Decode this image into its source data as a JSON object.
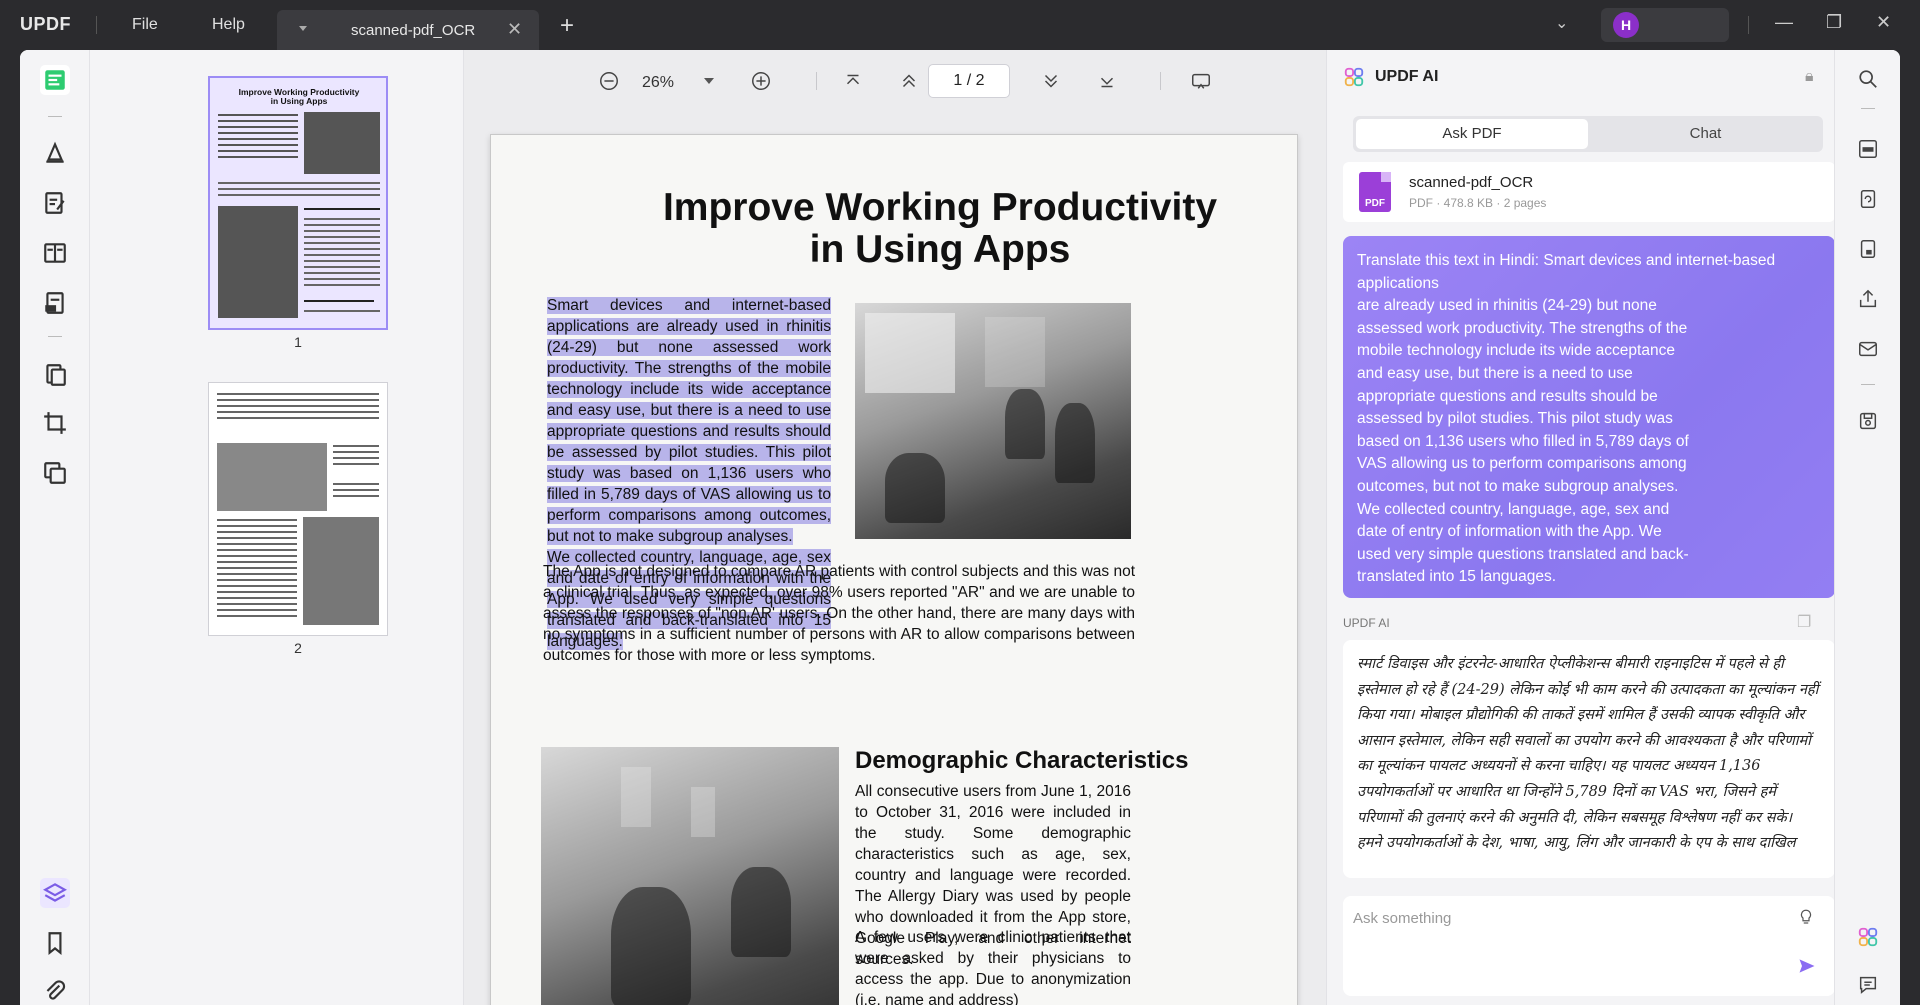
{
  "titlebar": {
    "logo": "UPDF",
    "menu": [
      "File",
      "Help"
    ],
    "tab_name": "scanned-pdf_OCR",
    "user_initial": "H"
  },
  "thumbnails": {
    "pages": [
      {
        "label": "1",
        "title": "Improve Working Productivity in Using Apps"
      },
      {
        "label": "2"
      }
    ]
  },
  "toolbar": {
    "zoom": "26%",
    "page_current": "1",
    "page_total": "2"
  },
  "document": {
    "title_line1": "Improve Working Productivity",
    "title_line2": "in Using Apps",
    "para1": "Smart devices and internet-based applications are already used in rhinitis (24-29) but none assessed work productivity. The strengths of the mobile technology include its wide acceptance and easy use, but there is a need to use appropriate questions and results should be assessed by pilot studies. This pilot study was based on 1,136 users who filled in 5,789 days of VAS allowing us to perform comparisons among outcomes, but not to make subgroup analyses.",
    "para2": "We collected country, language, age, sex and date of entry of information with the App. We used very simple questions translated and back-translated into 15 languages.",
    "para3": "The App is not designed to compare AR patients with control subjects and this was not a clinical trial. Thus, as expected, over 98% users reported \"AR\" and we are unable to assess the responses of \"non AR' users. On the other hand, there are many days with no symptoms in a sufficient number of persons with AR to allow comparisons between outcomes for those with more or less symptoms.",
    "heading2": "Demographic Characteristics",
    "para4": "All consecutive users from June 1, 2016 to October 31, 2016 were included in the study. Some demographic characteristics such as age, sex, country and language were recorded. The Allergy Diary was used by people who downloaded it from the App store, Google Play, and other internet sources.",
    "para5": "A few users were clinic patients that were asked by their physicians to access the app. Due to anonymization (i.e. name and address)"
  },
  "ai_panel": {
    "title": "UPDF AI",
    "tab_ask": "Ask PDF",
    "tab_chat": "Chat",
    "file_name": "scanned-pdf_OCR",
    "file_meta": "PDF · 478.8 KB · 2 pages",
    "file_icon_label": "PDF",
    "user_message_lines": [
      "Translate this text in Hindi: Smart devices and internet-based",
      "applications",
      "are already used in rhinitis (24-29) but none",
      "assessed work productivity. The strengths of the",
      "mobile technology include its wide acceptance",
      "and easy use, but there is a need to use",
      "appropriate questions and results should be",
      "assessed by pilot studies. This pilot study was",
      "based on 1,136 users who filled in 5,789 days of",
      "VAS allowing us to perform comparisons among",
      "outcomes, but not to make subgroup analyses.",
      "We collected country, language, age, sex and",
      "date of entry of information with the App. We",
      "used very simple questions translated and back-",
      "translated into 15 languages."
    ],
    "ai_label": "UPDF AI",
    "answer": "स्मार्ट डिवाइस और इंटरनेट-आधारित ऐप्लीकेशन्स बीमारी राइनाइटिस में पहले से ही इस्तेमाल हो रहे हैं (24-29) लेकिन कोई भी काम करने की उत्पादकता का मूल्यांकन नहीं किया गया। मोबाइल प्रौद्योगिकी की ताकतें इसमें शामिल हैं उसकी व्यापक स्वीकृति और आसान इस्तेमाल, लेकिन सही सवालों का उपयोग करने की आवश्यकता है और परिणामों का मूल्यांकन पायलट अध्ययनों से करना चाहिए। यह पायलट अध्ययन 1,136 उपयोगकर्ताओं पर आधारित था जिन्होंने 5,789 दिनों का VAS भरा, जिसने हमें परिणामों की तुलनाएं करने की अनुमति दी, लेकिन सबसमूह विश्लेषण नहीं कर सके। हमने उपयोगकर्ताओं के देश, भाषा, आयु, लिंग और जानकारी के एप के साथ दाखिल",
    "ask_placeholder": "Ask something"
  }
}
